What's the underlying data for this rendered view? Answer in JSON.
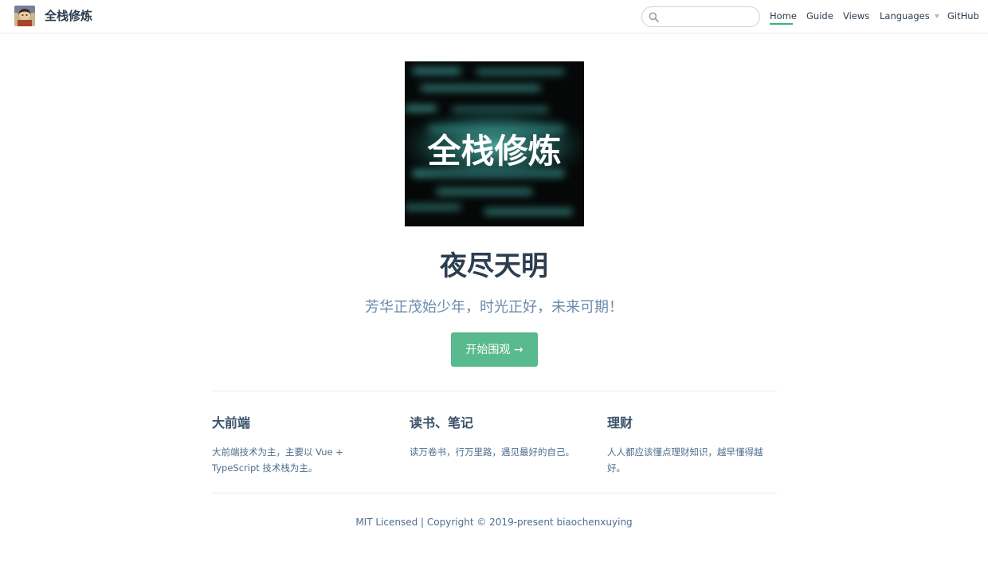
{
  "navbar": {
    "site_name": "全栈修炼",
    "search": {
      "value": "",
      "placeholder": ""
    },
    "links": [
      "Home",
      "Guide",
      "Views",
      "Languages",
      "GitHub"
    ]
  },
  "hero": {
    "image_text": "全栈修炼",
    "title": "夜尽天明",
    "description": "芳华正茂始少年，时光正好，未来可期！",
    "action": "开始围观 →"
  },
  "features": [
    {
      "title": "大前端",
      "details": "大前端技术为主，主要以 Vue + TypeScript 技术栈为主。"
    },
    {
      "title": "读书、笔记",
      "details": "读万卷书，行万里路，遇见最好的自己。"
    },
    {
      "title": "理财",
      "details": "人人都应该懂点理财知识，越早懂得越好。"
    }
  ],
  "footer": "MIT Licensed | Copyright © 2019-present biaochenxuying",
  "colors": {
    "accent": "#3eaf7c",
    "text": "#2c3e50",
    "muted": "#6a8bad"
  }
}
